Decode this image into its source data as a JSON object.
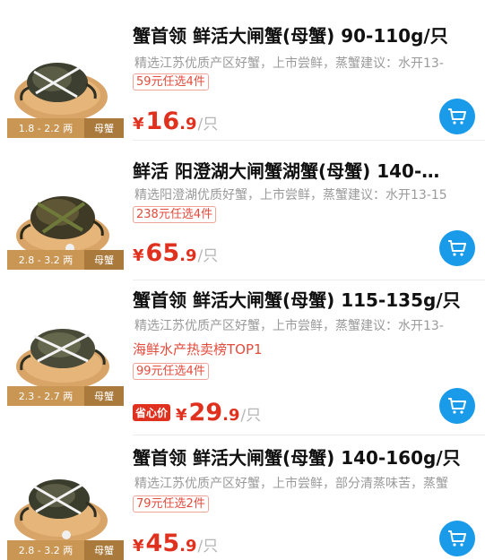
{
  "products": [
    {
      "title": "蟹首领 鲜活大闸蟹(母蟹) 90-110g/只",
      "description": "精选江苏优质产区好蟹，上市尝鲜，蒸蟹建议：水开13-",
      "promo": "59元任选4件",
      "price_currency": "¥",
      "price_int": "16",
      "price_dec": ".9",
      "price_unit": "/只",
      "weight": "1.8 - 2.2 两",
      "gender": "母蟹"
    },
    {
      "title": "鲜活 阳澄湖大闸蟹湖蟹(母蟹) 140-…",
      "description": "精选阳澄湖优质好蟹，上市尝鲜，蒸蟹建议：水开13-15",
      "promo": "238元任选4件",
      "price_currency": "¥",
      "price_int": "65",
      "price_dec": ".9",
      "price_unit": "/只",
      "weight": "2.8 - 3.2 两",
      "gender": "母蟹"
    },
    {
      "title": "蟹首领 鲜活大闸蟹(母蟹) 115-135g/只",
      "description": "精选江苏优质产区好蟹，上市尝鲜，蒸蟹建议：水开13-",
      "rank": "海鲜水产热卖榜TOP1",
      "promo": "99元任选4件",
      "badge": "省心价",
      "price_currency": "¥",
      "price_int": "29",
      "price_dec": ".9",
      "price_unit": "/只",
      "weight": "2.3 - 2.7 两",
      "gender": "母蟹"
    },
    {
      "title": "蟹首领 鲜活大闸蟹(母蟹) 140-160g/只",
      "description": "精选江苏优质产区好蟹，上市尝鲜，部分清蒸味苦，蒸蟹",
      "promo": "79元任选2件",
      "price_currency": "¥",
      "price_int": "45",
      "price_dec": ".9",
      "price_unit": "/只",
      "weight": "2.8 - 3.2 两",
      "gender": "母蟹"
    }
  ],
  "colors": {
    "price": "#e0301e",
    "cart": "#1a9bea",
    "plate": "#d9a467",
    "band": "#c99654"
  },
  "icons": {
    "cart": "shopping-cart-icon",
    "product": "crab-on-plate-image"
  }
}
